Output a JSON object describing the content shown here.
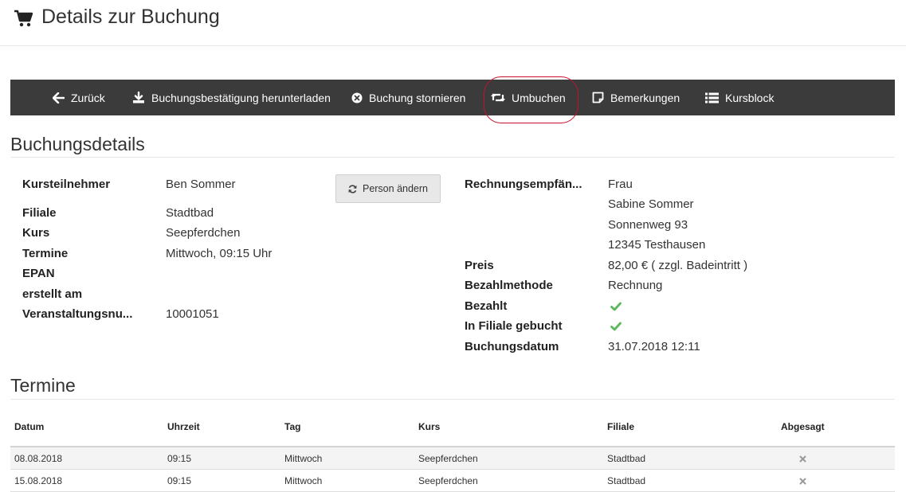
{
  "header": {
    "title": "Details zur Buchung",
    "icon": "cart-icon"
  },
  "toolbar": {
    "back": "Zurück",
    "download": "Buchungsbestätigung herunterladen",
    "cancel": "Buchung stornieren",
    "rebook": "Umbuchen",
    "notes": "Bemerkungen",
    "courseblock": "Kursblock"
  },
  "booking": {
    "section_title": "Buchungsdetails",
    "participant_label": "Kursteilnehmer",
    "participant_value": "Ben Sommer",
    "branch_label": "Filiale",
    "branch_value": "Stadtbad",
    "course_label": "Kurs",
    "course_value": "Seepferdchen",
    "dates_label": "Termine",
    "dates_value": "Mittwoch, 09:15 Uhr",
    "epan_label": "EPAN",
    "created_label": "erstellt am",
    "event_no_label": "Veranstaltungsnu...",
    "event_no_value": "10001051",
    "change_person_button": "Person ändern",
    "recipient_label": "Rechnungsempfän...",
    "recipient_lines": [
      "Frau",
      "Sabine Sommer",
      "Sonnenweg 93",
      "12345 Testhausen"
    ],
    "price_label": "Preis",
    "price_value": "82,00 € ( zzgl. Badeintritt )",
    "payment_method_label": "Bezahlmethode",
    "payment_method_value": "Rechnung",
    "paid_label": "Bezahlt",
    "branch_booked_label": "In Filiale gebucht",
    "booking_date_label": "Buchungsdatum",
    "booking_date_value": "31.07.2018 12:11",
    "check_color": "#5cb85c"
  },
  "appointments": {
    "section_title": "Termine",
    "columns": [
      "Datum",
      "Uhrzeit",
      "Tag",
      "Kurs",
      "Filiale",
      "Abgesagt"
    ],
    "rows": [
      [
        "08.08.2018",
        "09:15",
        "Mittwoch",
        "Seepferdchen",
        "Stadtbad"
      ],
      [
        "15.08.2018",
        "09:15",
        "Mittwoch",
        "Seepferdchen",
        "Stadtbad"
      ]
    ]
  },
  "colors": {
    "toolbar_bg": "#3b3b3b",
    "highlight_ring": "#c8102e"
  }
}
